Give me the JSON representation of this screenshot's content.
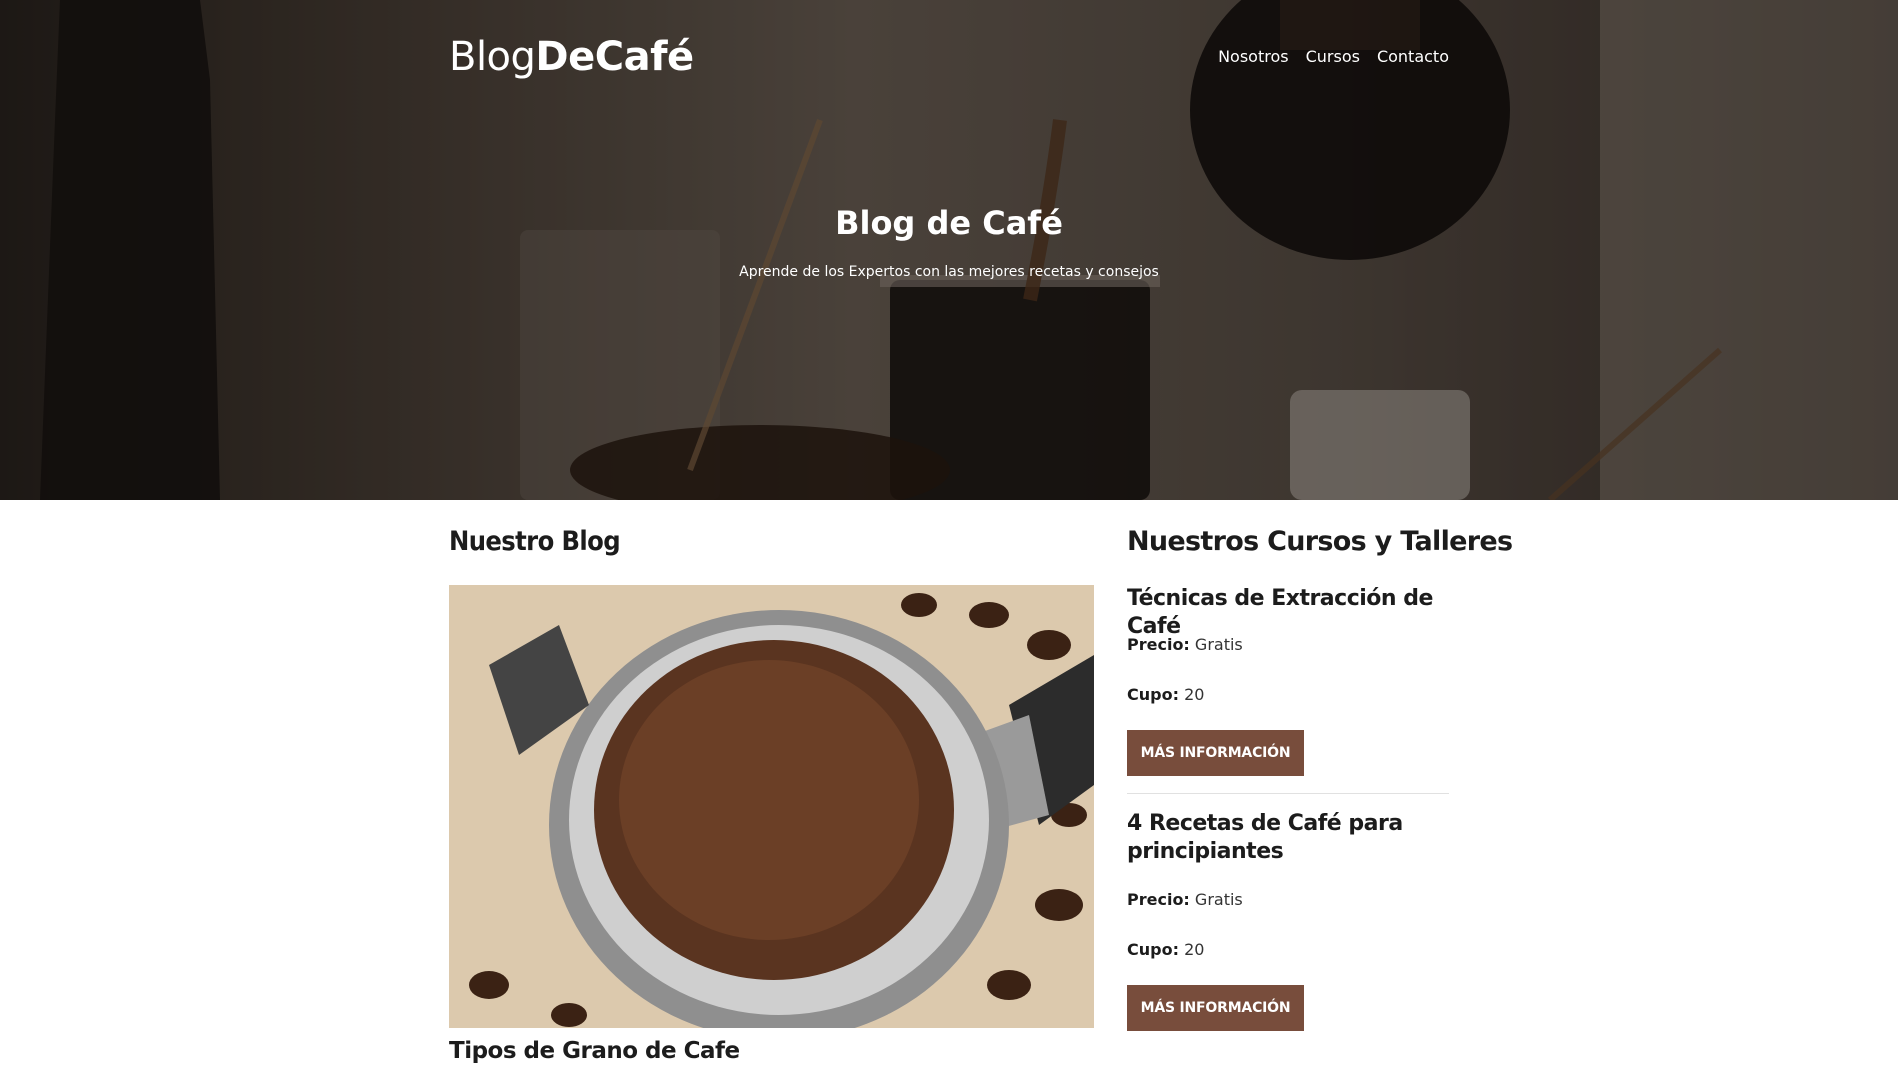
{
  "header": {
    "brand_light": "Blog",
    "brand_bold": "DeCafé",
    "nav": [
      "Nosotros",
      "Cursos",
      "Contacto"
    ],
    "hero_title": "Blog de Café",
    "hero_subtitle": "Aprende de los Expertos con las mejores recetas y consejos"
  },
  "blog": {
    "heading": "Nuestro Blog",
    "posts": [
      {
        "title": "Tipos de Grano de Cafe"
      }
    ]
  },
  "courses": {
    "heading": "Nuestros Cursos y Talleres",
    "items": [
      {
        "title": "Técnicas de Extracción de Café",
        "price_label": "Precio:",
        "price_value": "Gratis",
        "quota_label": "Cupo:",
        "quota_value": "20",
        "button": "MÁS INFORMACIÓN"
      },
      {
        "title": "4 Recetas de Café para principiantes",
        "price_label": "Precio:",
        "price_value": "Gratis",
        "quota_label": "Cupo:",
        "quota_value": "20",
        "button": "MÁS INFORMACIÓN"
      }
    ]
  },
  "colors": {
    "button_bg": "#784d3c",
    "text_dark": "#1c1c1c",
    "divider": "#e1e1e1"
  }
}
